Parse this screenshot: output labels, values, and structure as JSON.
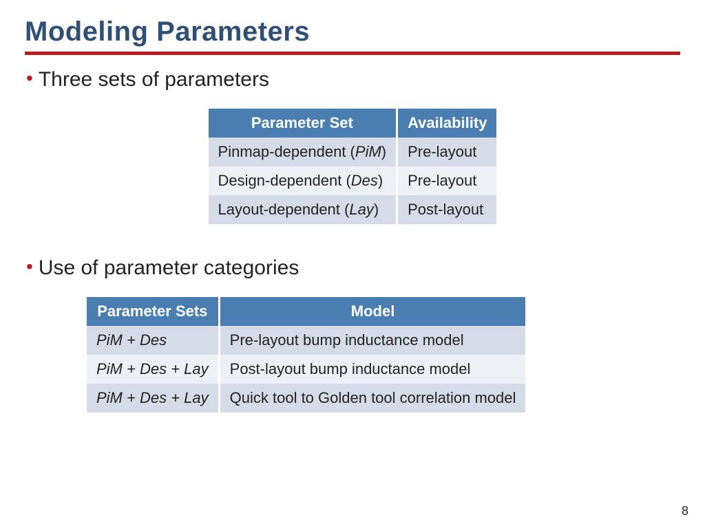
{
  "title": "Modeling Parameters",
  "bullets": {
    "b1": "Three sets of parameters",
    "b2": "Use of parameter categories"
  },
  "table1": {
    "h1": "Parameter Set",
    "h2": "Availability",
    "r1c1a": "Pinmap-dependent (",
    "r1c1b": "PiM",
    "r1c1c": ")",
    "r1c2": "Pre-layout",
    "r2c1a": "Design-dependent (",
    "r2c1b": "Des",
    "r2c1c": ")",
    "r2c2": "Pre-layout",
    "r3c1a": "Layout-dependent (",
    "r3c1b": "Lay",
    "r3c1c": ")",
    "r3c2": "Post-layout"
  },
  "table2": {
    "h1": "Parameter Sets",
    "h2": "Model",
    "r1c1": "PiM + Des",
    "r1c2": "Pre-layout bump inductance model",
    "r2c1": "PiM + Des + Lay",
    "r2c2": "Post-layout bump inductance model",
    "r3c1": "PiM + Des + Lay",
    "r3c2": "Quick tool to Golden tool correlation model"
  },
  "page_number": "8",
  "chart_data": [
    {
      "type": "table",
      "title": "Three sets of parameters",
      "columns": [
        "Parameter Set",
        "Availability"
      ],
      "rows": [
        [
          "Pinmap-dependent (PiM)",
          "Pre-layout"
        ],
        [
          "Design-dependent (Des)",
          "Pre-layout"
        ],
        [
          "Layout-dependent (Lay)",
          "Post-layout"
        ]
      ]
    },
    {
      "type": "table",
      "title": "Use of parameter categories",
      "columns": [
        "Parameter Sets",
        "Model"
      ],
      "rows": [
        [
          "PiM + Des",
          "Pre-layout bump inductance model"
        ],
        [
          "PiM + Des + Lay",
          "Post-layout bump inductance model"
        ],
        [
          "PiM + Des + Lay",
          "Quick tool to Golden tool correlation model"
        ]
      ]
    }
  ]
}
